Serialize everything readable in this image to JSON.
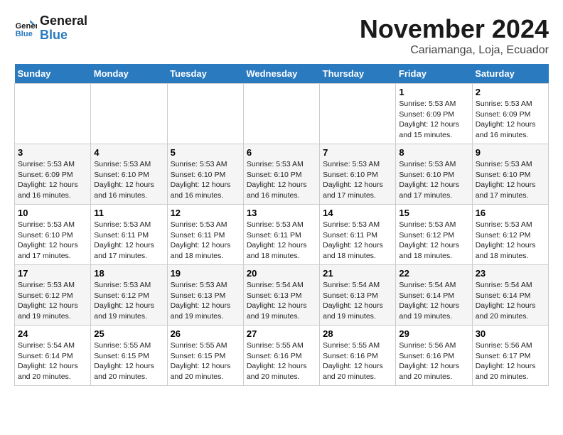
{
  "header": {
    "logo_line1": "General",
    "logo_line2": "Blue",
    "month_year": "November 2024",
    "location": "Cariamanga, Loja, Ecuador"
  },
  "weekdays": [
    "Sunday",
    "Monday",
    "Tuesday",
    "Wednesday",
    "Thursday",
    "Friday",
    "Saturday"
  ],
  "weeks": [
    [
      {
        "day": "",
        "info": ""
      },
      {
        "day": "",
        "info": ""
      },
      {
        "day": "",
        "info": ""
      },
      {
        "day": "",
        "info": ""
      },
      {
        "day": "",
        "info": ""
      },
      {
        "day": "1",
        "info": "Sunrise: 5:53 AM\nSunset: 6:09 PM\nDaylight: 12 hours and 15 minutes."
      },
      {
        "day": "2",
        "info": "Sunrise: 5:53 AM\nSunset: 6:09 PM\nDaylight: 12 hours and 16 minutes."
      }
    ],
    [
      {
        "day": "3",
        "info": "Sunrise: 5:53 AM\nSunset: 6:09 PM\nDaylight: 12 hours and 16 minutes."
      },
      {
        "day": "4",
        "info": "Sunrise: 5:53 AM\nSunset: 6:10 PM\nDaylight: 12 hours and 16 minutes."
      },
      {
        "day": "5",
        "info": "Sunrise: 5:53 AM\nSunset: 6:10 PM\nDaylight: 12 hours and 16 minutes."
      },
      {
        "day": "6",
        "info": "Sunrise: 5:53 AM\nSunset: 6:10 PM\nDaylight: 12 hours and 16 minutes."
      },
      {
        "day": "7",
        "info": "Sunrise: 5:53 AM\nSunset: 6:10 PM\nDaylight: 12 hours and 17 minutes."
      },
      {
        "day": "8",
        "info": "Sunrise: 5:53 AM\nSunset: 6:10 PM\nDaylight: 12 hours and 17 minutes."
      },
      {
        "day": "9",
        "info": "Sunrise: 5:53 AM\nSunset: 6:10 PM\nDaylight: 12 hours and 17 minutes."
      }
    ],
    [
      {
        "day": "10",
        "info": "Sunrise: 5:53 AM\nSunset: 6:10 PM\nDaylight: 12 hours and 17 minutes."
      },
      {
        "day": "11",
        "info": "Sunrise: 5:53 AM\nSunset: 6:11 PM\nDaylight: 12 hours and 17 minutes."
      },
      {
        "day": "12",
        "info": "Sunrise: 5:53 AM\nSunset: 6:11 PM\nDaylight: 12 hours and 18 minutes."
      },
      {
        "day": "13",
        "info": "Sunrise: 5:53 AM\nSunset: 6:11 PM\nDaylight: 12 hours and 18 minutes."
      },
      {
        "day": "14",
        "info": "Sunrise: 5:53 AM\nSunset: 6:11 PM\nDaylight: 12 hours and 18 minutes."
      },
      {
        "day": "15",
        "info": "Sunrise: 5:53 AM\nSunset: 6:12 PM\nDaylight: 12 hours and 18 minutes."
      },
      {
        "day": "16",
        "info": "Sunrise: 5:53 AM\nSunset: 6:12 PM\nDaylight: 12 hours and 18 minutes."
      }
    ],
    [
      {
        "day": "17",
        "info": "Sunrise: 5:53 AM\nSunset: 6:12 PM\nDaylight: 12 hours and 19 minutes."
      },
      {
        "day": "18",
        "info": "Sunrise: 5:53 AM\nSunset: 6:12 PM\nDaylight: 12 hours and 19 minutes."
      },
      {
        "day": "19",
        "info": "Sunrise: 5:53 AM\nSunset: 6:13 PM\nDaylight: 12 hours and 19 minutes."
      },
      {
        "day": "20",
        "info": "Sunrise: 5:54 AM\nSunset: 6:13 PM\nDaylight: 12 hours and 19 minutes."
      },
      {
        "day": "21",
        "info": "Sunrise: 5:54 AM\nSunset: 6:13 PM\nDaylight: 12 hours and 19 minutes."
      },
      {
        "day": "22",
        "info": "Sunrise: 5:54 AM\nSunset: 6:14 PM\nDaylight: 12 hours and 19 minutes."
      },
      {
        "day": "23",
        "info": "Sunrise: 5:54 AM\nSunset: 6:14 PM\nDaylight: 12 hours and 20 minutes."
      }
    ],
    [
      {
        "day": "24",
        "info": "Sunrise: 5:54 AM\nSunset: 6:14 PM\nDaylight: 12 hours and 20 minutes."
      },
      {
        "day": "25",
        "info": "Sunrise: 5:55 AM\nSunset: 6:15 PM\nDaylight: 12 hours and 20 minutes."
      },
      {
        "day": "26",
        "info": "Sunrise: 5:55 AM\nSunset: 6:15 PM\nDaylight: 12 hours and 20 minutes."
      },
      {
        "day": "27",
        "info": "Sunrise: 5:55 AM\nSunset: 6:16 PM\nDaylight: 12 hours and 20 minutes."
      },
      {
        "day": "28",
        "info": "Sunrise: 5:55 AM\nSunset: 6:16 PM\nDaylight: 12 hours and 20 minutes."
      },
      {
        "day": "29",
        "info": "Sunrise: 5:56 AM\nSunset: 6:16 PM\nDaylight: 12 hours and 20 minutes."
      },
      {
        "day": "30",
        "info": "Sunrise: 5:56 AM\nSunset: 6:17 PM\nDaylight: 12 hours and 20 minutes."
      }
    ]
  ]
}
